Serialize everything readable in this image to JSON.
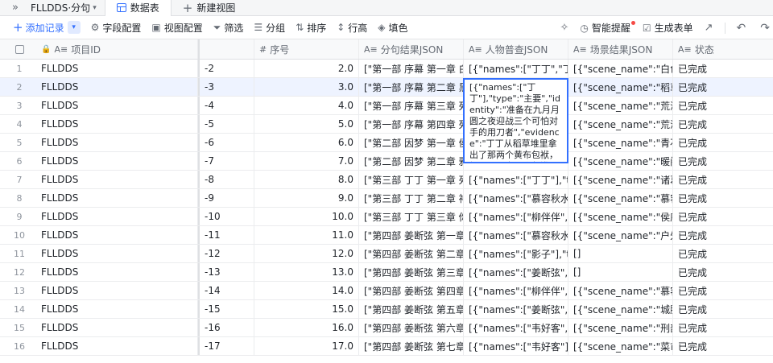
{
  "tabbar": {
    "base_name": "FLLDDS·分句",
    "tabs": [
      {
        "label": "数据表"
      }
    ],
    "new_view_label": "新建视图"
  },
  "toolbar": {
    "add_label": "添加记录",
    "items": [
      {
        "label": "字段配置",
        "icon": "field-config-icon"
      },
      {
        "label": "视图配置",
        "icon": "view-config-icon"
      },
      {
        "label": "筛选",
        "icon": "filter-icon"
      },
      {
        "label": "分组",
        "icon": "group-icon"
      },
      {
        "label": "排序",
        "icon": "sort-icon"
      },
      {
        "label": "行高",
        "icon": "row-height-icon"
      },
      {
        "label": "填色",
        "icon": "fill-color-icon"
      }
    ],
    "right": {
      "smart_reminder": "智能提醒",
      "generate_form": "生成表单"
    }
  },
  "columns": {
    "project_id": "项目ID",
    "seq": "序号",
    "fen": "分句结果JSON",
    "ren": "人物普查JSON",
    "scene": "场景结果JSON",
    "status": "状态"
  },
  "rows": [
    {
      "num": "1",
      "id": "FLLDDS",
      "split": "-2",
      "seq": "2.0",
      "fen": "[\"第一部 序幕 第一章 白...",
      "ren": "[{\"names\":[\"丁丁\",\"丁宁...",
      "scene": "[{\"scene_name\":\"白色...",
      "status": "已完成"
    },
    {
      "num": "2",
      "id": "FLLDDS",
      "split": "-3",
      "seq": "3.0",
      "fen": "[\"第一部 序幕 第二章 黑...",
      "ren": "",
      "scene": "[{\"scene_name\":\"稻草...",
      "status": "已完成"
    },
    {
      "num": "3",
      "id": "FLLDDS",
      "split": "-4",
      "seq": "4.0",
      "fen": "[\"第一部 序幕 第三章 死...",
      "ren": "",
      "scene": "[{\"scene_name\":\"荒漠\",...",
      "status": "已完成"
    },
    {
      "num": "4",
      "id": "FLLDDS",
      "split": "-5",
      "seq": "5.0",
      "fen": "[\"第一部 序幕 第四章 死...",
      "ren": "",
      "scene": "[{\"scene_name\":\"荒漠...",
      "status": "已完成"
    },
    {
      "num": "5",
      "id": "FLLDDS",
      "split": "-6",
      "seq": "6.0",
      "fen": "[\"第二部 因梦 第一章 侯...",
      "ren": "",
      "scene": "[{\"scene_name\":\"青石...",
      "status": "已完成"
    },
    {
      "num": "6",
      "id": "FLLDDS",
      "split": "-7",
      "seq": "7.0",
      "fen": "[\"第二部 因梦 第二章 雅...",
      "ren": "",
      "scene": "[{\"scene_name\":\"暖阁\",...",
      "status": "已完成"
    },
    {
      "num": "7",
      "id": "FLLDDS",
      "split": "-8",
      "seq": "8.0",
      "fen": "[\"第三部 丁丁 第一章 死...",
      "ren": "[{\"names\":[\"丁丁\"],\"typ...",
      "scene": "[{\"scene_name\":\"诸葛...",
      "status": "已完成"
    },
    {
      "num": "8",
      "id": "FLLDDS",
      "split": "-9",
      "seq": "9.0",
      "fen": "[\"第三部 丁丁 第二章 神...",
      "ren": "[{\"names\":[\"慕容秋水\"],...",
      "scene": "[{\"scene_name\":\"慕容...",
      "status": "已完成"
    },
    {
      "num": "9",
      "id": "FLLDDS",
      "split": "-10",
      "seq": "10.0",
      "fen": "[\"第三部 丁丁 第三章 你...",
      "ren": "[{\"names\":[\"柳伴伴\",\"伴...",
      "scene": "[{\"scene_name\":\"侯府...",
      "status": "已完成"
    },
    {
      "num": "10",
      "id": "FLLDDS",
      "split": "-11",
      "seq": "11.0",
      "fen": "[\"第四部 姜断弦 第一章 ...",
      "ren": "[{\"names\":[\"慕容秋水\"],...",
      "scene": "[{\"scene_name\":\"户外\",...",
      "status": "已完成"
    },
    {
      "num": "11",
      "id": "FLLDDS",
      "split": "-12",
      "seq": "12.0",
      "fen": "[\"第四部 姜断弦 第二章 ...",
      "ren": "[{\"names\":[\"影子\"],\"typ...",
      "scene": "[]",
      "status": "已完成"
    },
    {
      "num": "12",
      "id": "FLLDDS",
      "split": "-13",
      "seq": "13.0",
      "fen": "[\"第四部 姜断弦 第三章 ...",
      "ren": "[{\"names\":[\"姜断弦\",\"姜...",
      "scene": "[]",
      "status": "已完成"
    },
    {
      "num": "13",
      "id": "FLLDDS",
      "split": "-14",
      "seq": "14.0",
      "fen": "[\"第四部 姜断弦 第四章 ...",
      "ren": "[{\"names\":[\"柳伴伴\",\"伴...",
      "scene": "[{\"scene_name\":\"慕容...",
      "status": "已完成"
    },
    {
      "num": "14",
      "id": "FLLDDS",
      "split": "-15",
      "seq": "15.0",
      "fen": "[\"第四部 姜断弦 第五章 ...",
      "ren": "[{\"names\":[\"姜断弦\",\"影...",
      "scene": "[{\"scene_name\":\"城脚...",
      "status": "已完成"
    },
    {
      "num": "15",
      "id": "FLLDDS",
      "split": "-16",
      "seq": "16.0",
      "fen": "[\"第四部 姜断弦 第六章 ...",
      "ren": "[{\"names\":[\"韦好客\",\"韦...",
      "scene": "[{\"scene_name\":\"刑部...",
      "status": "已完成"
    },
    {
      "num": "16",
      "id": "FLLDDS",
      "split": "-17",
      "seq": "17.0",
      "fen": "[\"第四部 姜断弦 第七章 ...",
      "ren": "[{\"names\":[\"韦好客\"],\"t...",
      "scene": "[{\"scene_name\":\"菜市...",
      "status": "已完成"
    }
  ],
  "editor_text": "[{\"names\":[\"丁丁\"],\"type\":\"主要\",\"identity\":\"准备在九月月圆之夜迎战三个可怕对手的用刀者\",\"evidence\":\"丁丁从稻草堆里拿出了那两个黄布包袱，解开了其中一个包袱，里面有一把刀\"}]"
}
